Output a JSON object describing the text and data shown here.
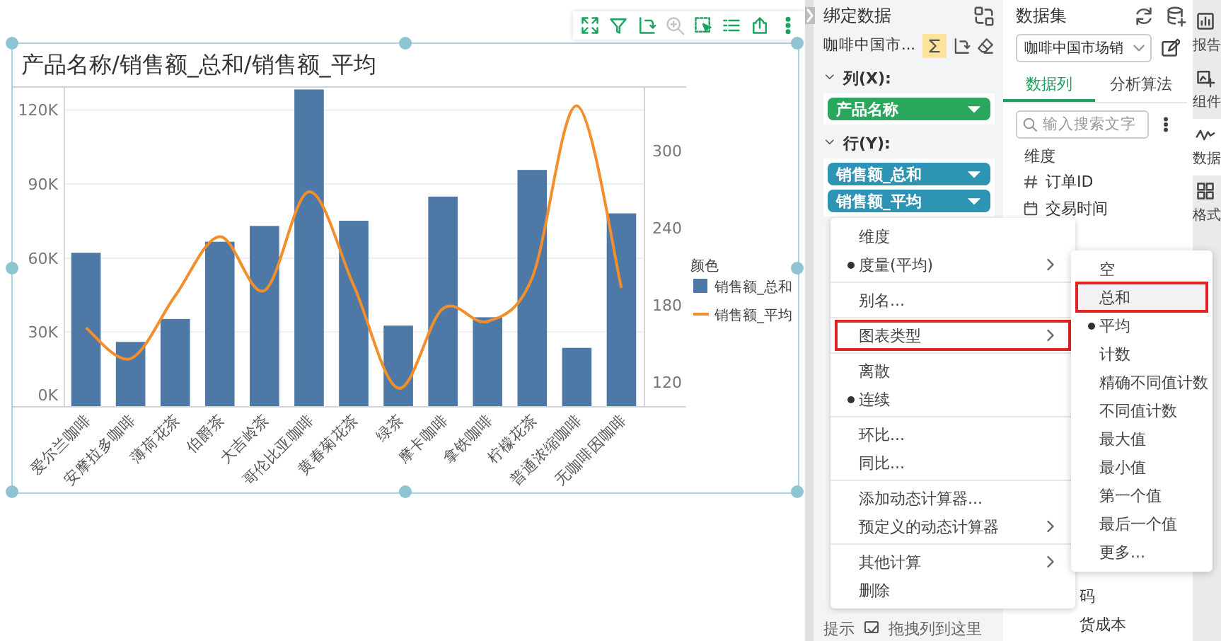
{
  "toolbar": [
    {
      "kind": "fullscreen",
      "disabled": false
    },
    {
      "kind": "filter",
      "disabled": false
    },
    {
      "kind": "swap",
      "disabled": false
    },
    {
      "kind": "zoom",
      "disabled": true
    },
    {
      "kind": "select",
      "disabled": false
    },
    {
      "kind": "list",
      "disabled": false
    },
    {
      "kind": "export",
      "disabled": false
    },
    {
      "kind": "more",
      "disabled": false
    }
  ],
  "chart": {
    "title": "产品名称/销售额_总和/销售额_平均",
    "chart_data": {
      "type": "bar",
      "grid": true,
      "legend": {
        "title": "颜色"
      },
      "categories": [
        "爱尔兰咖啡",
        "安摩拉多咖啡",
        "薄荷花茶",
        "伯爵茶",
        "大吉岭茶",
        "哥伦比亚咖啡",
        "黄春菊花茶",
        "绿茶",
        "摩卡咖啡",
        "拿铁咖啡",
        "柠檬花茶",
        "普通浓缩咖啡",
        "无咖啡因咖啡"
      ],
      "series": [
        {
          "name": "销售额_总和",
          "color": "#4e79a7",
          "values": [
            62.1,
            26,
            35.3,
            66.6,
            73,
            128.3,
            75.1,
            32.6,
            84.9,
            36,
            95.7,
            23.6,
            78.1
          ]
        },
        {
          "name": "销售额_平均",
          "color": "#f28e2b",
          "type": "line",
          "axis": "y2",
          "values": [
            162,
            138,
            187,
            233,
            191,
            268,
            195,
            115,
            177,
            167,
            201,
            335,
            193
          ]
        }
      ],
      "ylim": [
        0,
        129
      ],
      "yticks": [
        {
          "value": 0,
          "label": "0K"
        },
        {
          "value": 30,
          "label": "30K"
        },
        {
          "value": 60,
          "label": "60K"
        },
        {
          "value": 90,
          "label": "90K"
        },
        {
          "value": 120,
          "label": "120K"
        }
      ],
      "y2lim": [
        101,
        349
      ],
      "y2ticks": [
        120,
        180,
        240,
        300
      ]
    }
  },
  "binding_panel": {
    "title": "绑定数据",
    "dataset": "咖啡中国市...",
    "sum_on": true,
    "columns_label": "列(X):",
    "columns": [
      {
        "label": "产品名称",
        "kind": "dimension"
      }
    ],
    "rows_label": "行(Y):",
    "rows": [
      {
        "label": "销售额_总和",
        "kind": "measure"
      },
      {
        "label": "销售额_平均",
        "kind": "measure"
      }
    ],
    "hint_label": "提示",
    "hint_text": "拖拽列到这里"
  },
  "dataset_panel": {
    "title": "数据集",
    "dataset": "咖啡中国市场销",
    "tabs": [
      {
        "label": "数据列",
        "selected": true
      },
      {
        "label": "分析算法",
        "selected": false
      }
    ],
    "search": {
      "placeholder": "输入搜索文字"
    },
    "section": "维度",
    "fields": [
      {
        "label": "订单ID",
        "kind": "number"
      },
      {
        "label": "交易时间",
        "kind": "date"
      }
    ],
    "lower_fields": [
      "码",
      "货成本"
    ]
  },
  "sidebar": [
    {
      "label": "报告",
      "kind": "report",
      "selected": false
    },
    {
      "label": "组件",
      "kind": "component",
      "selected": false
    },
    {
      "label": "数据",
      "kind": "data",
      "selected": true
    },
    {
      "label": "格式",
      "kind": "format",
      "selected": false
    }
  ],
  "context_menu": {
    "groups": [
      {
        "items": [
          {
            "label": "维度",
            "checked": false,
            "submenu": false,
            "highlighted": false
          },
          {
            "label": "度量(平均)",
            "checked": true,
            "submenu": true,
            "highlighted": false
          }
        ]
      },
      {
        "items": [
          {
            "label": "别名...",
            "checked": false,
            "submenu": false,
            "highlighted": false
          }
        ]
      },
      {
        "items": [
          {
            "label": "图表类型",
            "checked": false,
            "submenu": true,
            "highlighted": true
          }
        ]
      },
      {
        "items": [
          {
            "label": "离散",
            "checked": false,
            "submenu": false,
            "highlighted": false
          },
          {
            "label": "连续",
            "checked": true,
            "submenu": false,
            "highlighted": false
          }
        ]
      },
      {
        "items": [
          {
            "label": "环比...",
            "checked": false,
            "submenu": false,
            "highlighted": false
          },
          {
            "label": "同比...",
            "checked": false,
            "submenu": false,
            "highlighted": false
          }
        ]
      },
      {
        "items": [
          {
            "label": "添加动态计算器...",
            "checked": false,
            "submenu": false,
            "highlighted": false
          },
          {
            "label": "预定义的动态计算器",
            "checked": false,
            "submenu": true,
            "highlighted": false
          }
        ]
      },
      {
        "items": [
          {
            "label": "其他计算",
            "checked": false,
            "submenu": true,
            "highlighted": false
          },
          {
            "label": "删除",
            "checked": false,
            "submenu": false,
            "highlighted": false
          }
        ]
      }
    ]
  },
  "submenu": {
    "items": [
      {
        "label": "空",
        "checked": false,
        "highlighted": false
      },
      {
        "label": "总和",
        "checked": false,
        "highlighted": true
      },
      {
        "label": "平均",
        "checked": true,
        "highlighted": false
      },
      {
        "label": "计数",
        "checked": false,
        "highlighted": false
      },
      {
        "label": "精确不同值计数",
        "checked": false,
        "highlighted": false
      },
      {
        "label": "不同值计数",
        "checked": false,
        "highlighted": false
      },
      {
        "label": "最大值",
        "checked": false,
        "highlighted": false
      },
      {
        "label": "最小值",
        "checked": false,
        "highlighted": false
      },
      {
        "label": "第一个值",
        "checked": false,
        "highlighted": false
      },
      {
        "label": "最后一个值",
        "checked": false,
        "highlighted": false
      },
      {
        "label": "更多...",
        "checked": false,
        "highlighted": false
      }
    ]
  }
}
